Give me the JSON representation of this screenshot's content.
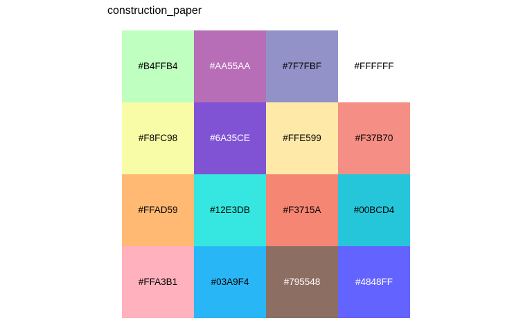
{
  "title": "construction_paper",
  "chart_data": {
    "type": "heatmap",
    "title": "construction_paper",
    "columns": 4,
    "rows": 4,
    "cells": [
      {
        "label": "#B4FFB4",
        "color": "#B4FFB4",
        "text_color": "#000000",
        "alpha": 0.85
      },
      {
        "label": "#AA55AA",
        "color": "#AA55AA",
        "text_color": "#FFFFFF",
        "alpha": 0.85
      },
      {
        "label": "#7F7FBF",
        "color": "#7F7FBF",
        "text_color": "#000000",
        "alpha": 0.85
      },
      {
        "label": "#FFFFFF",
        "color": "#FFFFFF",
        "text_color": "#000000",
        "alpha": 0.85
      },
      {
        "label": "#F8FC98",
        "color": "#F8FC98",
        "text_color": "#000000",
        "alpha": 0.85
      },
      {
        "label": "#6A35CE",
        "color": "#6A35CE",
        "text_color": "#FFFFFF",
        "alpha": 0.85
      },
      {
        "label": "#FFE599",
        "color": "#FFE599",
        "text_color": "#000000",
        "alpha": 0.85
      },
      {
        "label": "#F37B70",
        "color": "#F37B70",
        "text_color": "#000000",
        "alpha": 0.85
      },
      {
        "label": "#FFAD59",
        "color": "#FFAD59",
        "text_color": "#000000",
        "alpha": 0.85
      },
      {
        "label": "#12E3DB",
        "color": "#12E3DB",
        "text_color": "#000000",
        "alpha": 0.85
      },
      {
        "label": "#F3715A",
        "color": "#F3715A",
        "text_color": "#000000",
        "alpha": 0.85
      },
      {
        "label": "#00BCD4",
        "color": "#00BCD4",
        "text_color": "#000000",
        "alpha": 0.85
      },
      {
        "label": "#FFA3B1",
        "color": "#FFA3B1",
        "text_color": "#000000",
        "alpha": 0.85
      },
      {
        "label": "#03A9F4",
        "color": "#03A9F4",
        "text_color": "#000000",
        "alpha": 0.85
      },
      {
        "label": "#795548",
        "color": "#795548",
        "text_color": "#FFFFFF",
        "alpha": 0.85
      },
      {
        "label": "#4848FF",
        "color": "#4848FF",
        "text_color": "#FFFFFF",
        "alpha": 0.85
      }
    ]
  }
}
